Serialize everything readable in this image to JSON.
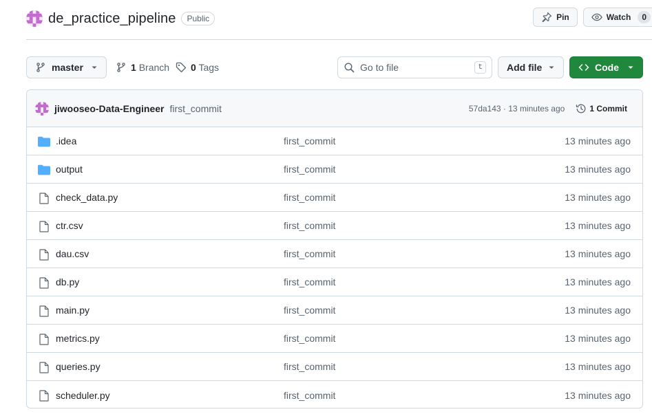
{
  "repo": {
    "name": "de_practice_pipeline",
    "visibility": "Public",
    "avatar_icon": "identicon-avatar",
    "avatar_color": "#c26ccf"
  },
  "header_actions": {
    "pin_label": "Pin",
    "watch_label": "Watch",
    "watch_count": "0"
  },
  "toolbar": {
    "branch": "master",
    "branch_count": "1",
    "branch_label": "Branch",
    "tag_count": "0",
    "tag_label": "Tags",
    "search_placeholder": "Go to file",
    "search_shortcut": "t",
    "add_file_label": "Add file",
    "code_label": "Code",
    "code_color": "#1f883d"
  },
  "latest_commit": {
    "author": "jiwooseo-Data-Engineer",
    "message": "first_commit",
    "meta": "57da143 · 13 minutes ago",
    "commit_count_label": "1 Commit"
  },
  "files": [
    {
      "name": ".idea",
      "type": "folder",
      "commit": "first_commit",
      "time": "13 minutes ago"
    },
    {
      "name": "output",
      "type": "folder",
      "commit": "first_commit",
      "time": "13 minutes ago"
    },
    {
      "name": "check_data.py",
      "type": "file",
      "commit": "first_commit",
      "time": "13 minutes ago"
    },
    {
      "name": "ctr.csv",
      "type": "file",
      "commit": "first_commit",
      "time": "13 minutes ago"
    },
    {
      "name": "dau.csv",
      "type": "file",
      "commit": "first_commit",
      "time": "13 minutes ago"
    },
    {
      "name": "db.py",
      "type": "file",
      "commit": "first_commit",
      "time": "13 minutes ago"
    },
    {
      "name": "main.py",
      "type": "file",
      "commit": "first_commit",
      "time": "13 minutes ago"
    },
    {
      "name": "metrics.py",
      "type": "file",
      "commit": "first_commit",
      "time": "13 minutes ago"
    },
    {
      "name": "queries.py",
      "type": "file",
      "commit": "first_commit",
      "time": "13 minutes ago"
    },
    {
      "name": "scheduler.py",
      "type": "file",
      "commit": "first_commit",
      "time": "13 minutes ago"
    }
  ],
  "colors": {
    "folder_icon": "#54aeff",
    "file_icon": "#59636e",
    "border": "#d1d9e0"
  }
}
